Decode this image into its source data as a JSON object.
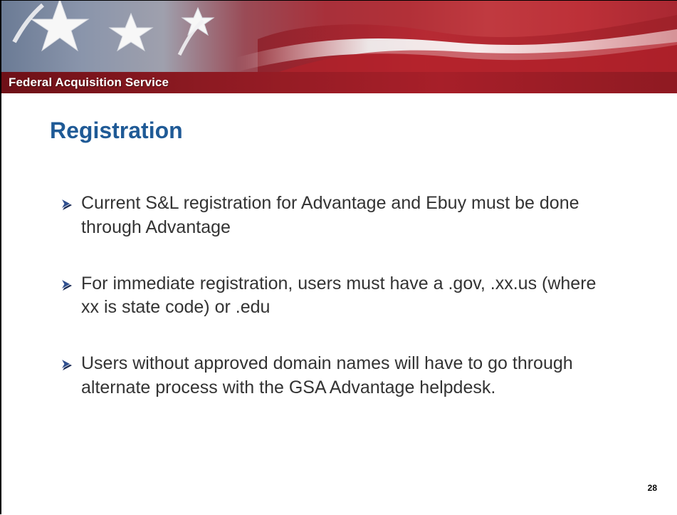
{
  "header": {
    "service_name": "Federal Acquisition Service"
  },
  "slide": {
    "title": "Registration",
    "bullets": [
      {
        "text": "Current S&L registration for Advantage and Ebuy must be done through Advantage"
      },
      {
        "text": "For immediate registration, users must have a .gov, .xx.us (where xx is state code) or .edu"
      },
      {
        "text": "Users without approved domain names will have to go through alternate process with the GSA Advantage helpdesk."
      }
    ],
    "page_number": "28"
  },
  "colors": {
    "title": "#1f5a96",
    "body_text": "#333333",
    "banner_red": "#a71f29",
    "bullet_fill": "#2f4f8f",
    "bullet_shadow": "#1a2a55"
  },
  "icons": {
    "bullet": "arrowhead-bullet-icon",
    "banner_image": "flag-banner-icon",
    "stars": "star-icon"
  }
}
